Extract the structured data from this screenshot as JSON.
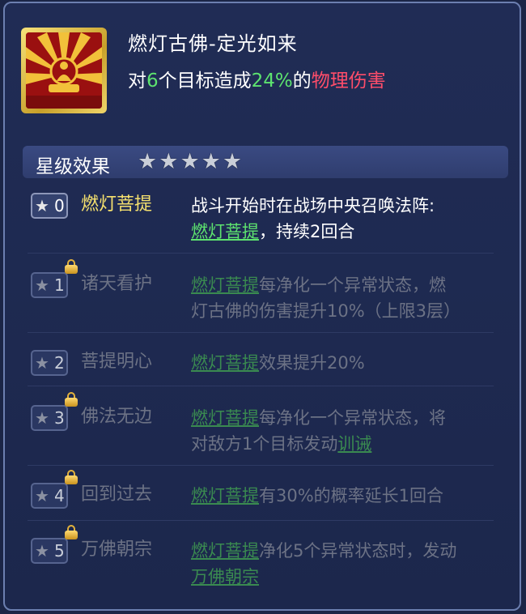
{
  "skill": {
    "title": "燃灯古佛-定光如来",
    "desc_prefix": "对",
    "target_count": "6",
    "desc_mid": "个目标造成",
    "percent": "24%",
    "desc_of": "的",
    "damage_type": "物理伤害",
    "icon": "buddha-sunburst-icon"
  },
  "star_effects": {
    "header_label": "星级效果",
    "stars_filled": 5,
    "star_glyph": "★"
  },
  "rows": [
    {
      "num": "0",
      "name": "燃灯菩提",
      "line1": "战斗开始时在战场中央召唤法阵:",
      "link1": "燃灯菩提",
      "after1": "，持续2回合",
      "unlocked": true
    },
    {
      "num": "1",
      "name": "诸天看护",
      "link1": "燃灯菩提",
      "after1": "每净化一个异常状态，燃",
      "line2": "灯古佛的伤害提升10%（上限3层）",
      "unlocked": false
    },
    {
      "num": "2",
      "name": "菩提明心",
      "link1": "燃灯菩提",
      "after1": "效果提升20%",
      "unlocked": false
    },
    {
      "num": "3",
      "name": "佛法无边",
      "link1": "燃灯菩提",
      "after1": "每净化一个异常状态，将",
      "line2": "对敌方1个目标发动",
      "link2": "训诫",
      "unlocked": false
    },
    {
      "num": "4",
      "name": "回到过去",
      "link1": "燃灯菩提",
      "after1": "有30%的概率延长1回合",
      "unlocked": false
    },
    {
      "num": "5",
      "name": "万佛朝宗",
      "link1": "燃灯菩提",
      "after1": "净化5个异常状态时，发动",
      "link2": "万佛朝宗",
      "unlocked": false
    }
  ]
}
